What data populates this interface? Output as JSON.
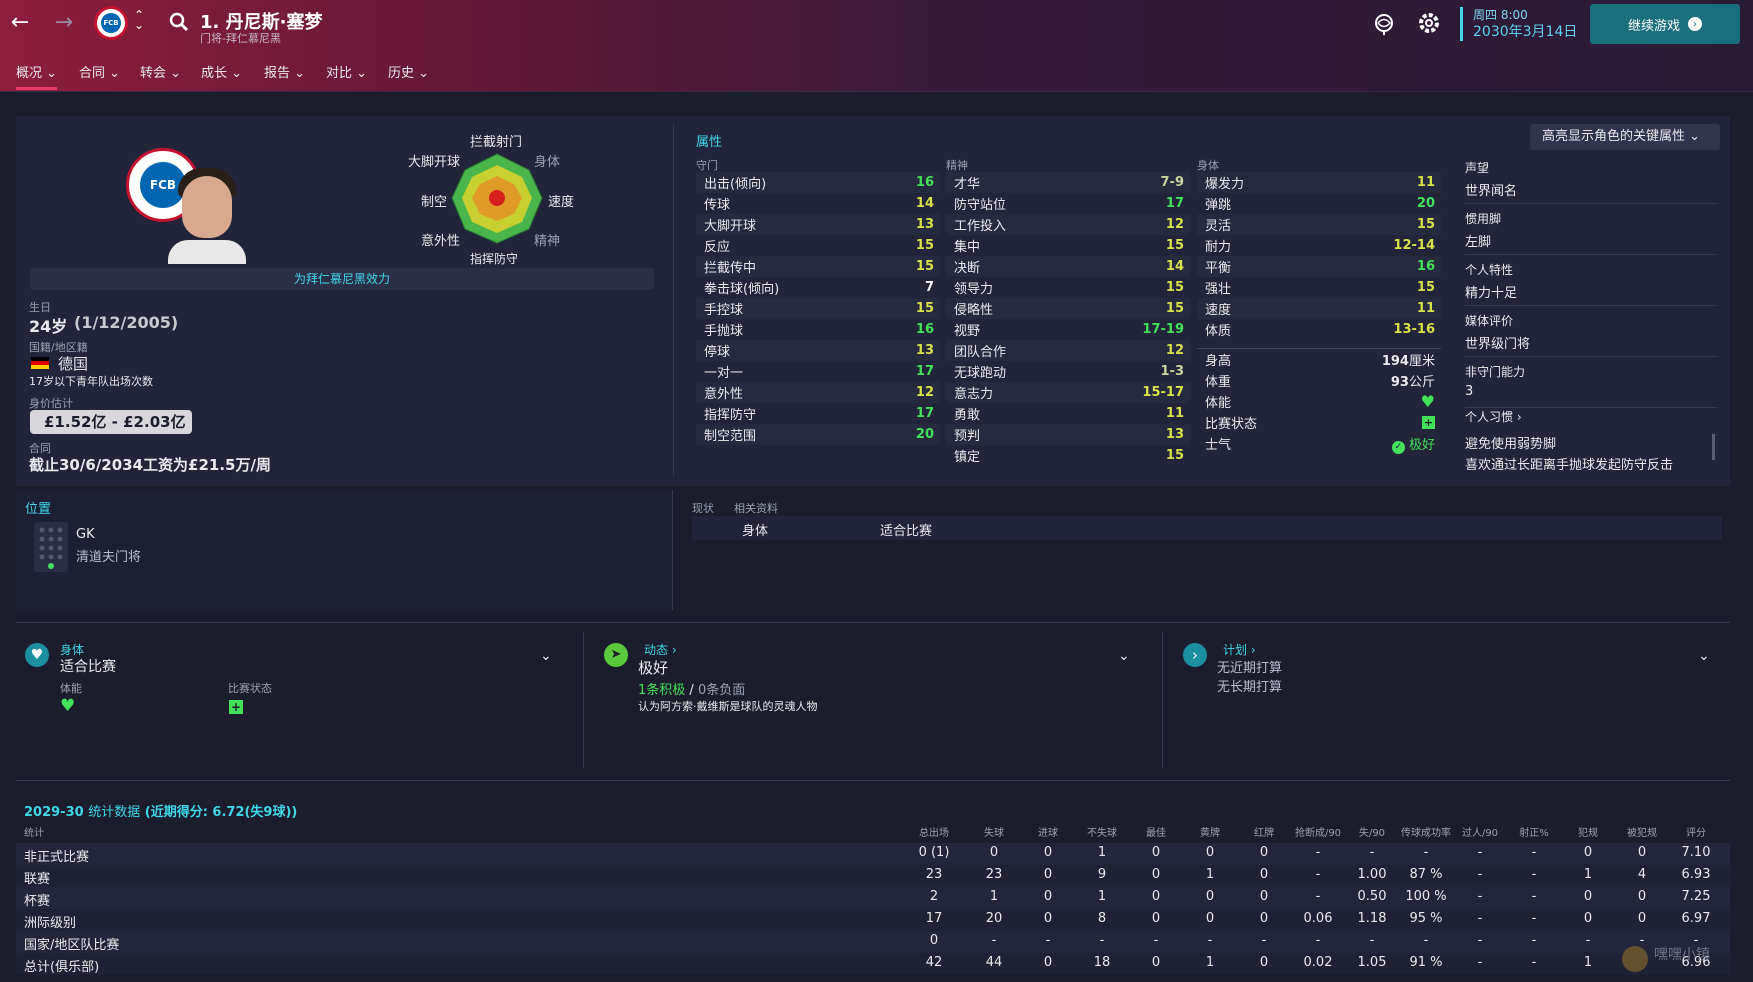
{
  "header": {
    "player_title": "1. 丹尼斯·塞梦",
    "player_subtitle": "门将-拜仁慕尼黑",
    "date_line1": "周四 8:00",
    "date_line2": "2030年3月14日",
    "continue": "继续游戏",
    "back_icon": "←",
    "forward_icon": "→",
    "search_icon": "⚲"
  },
  "menu": [
    "概况",
    "合同",
    "转会",
    "成长",
    "报告",
    "对比",
    "历史"
  ],
  "profile": {
    "plays_for": "为拜仁慕尼黑效力",
    "birth_label": "生日",
    "age": "24岁",
    "birth": "(1/12/2005)",
    "nation_label": "国籍/地区籍",
    "nation": "德国",
    "youth_caps": "17岁以下青年队出场次数",
    "value_label": "身价估计",
    "value": "£1.52亿 - £2.03亿",
    "contract_label": "合同",
    "contract": "截止30/6/2034工资为£21.5万/周"
  },
  "radar": {
    "top": "拦截射门",
    "tl": "大脚开球",
    "tr": "身体",
    "left": "制空",
    "right": "速度",
    "bl": "意外性",
    "br": "精神",
    "bottom": "指挥防守"
  },
  "attributes": {
    "title": "属性",
    "highlight": "高亮显示角色的关键属性",
    "gk_header": "守门",
    "mental_header": "精神",
    "physical_header": "身体",
    "gk": [
      [
        "出击(倾向)",
        "16",
        "g"
      ],
      [
        "传球",
        "14",
        "y"
      ],
      [
        "大脚开球",
        "13",
        "y"
      ],
      [
        "反应",
        "15",
        "y"
      ],
      [
        "拦截传中",
        "15",
        "y"
      ],
      [
        "拳击球(倾向)",
        "7",
        "w"
      ],
      [
        "手控球",
        "15",
        "y"
      ],
      [
        "手抛球",
        "16",
        "g"
      ],
      [
        "停球",
        "13",
        "y"
      ],
      [
        "一对一",
        "17",
        "g"
      ],
      [
        "意外性",
        "12",
        "y"
      ],
      [
        "指挥防守",
        "17",
        "g"
      ],
      [
        "制空范围",
        "20",
        "g"
      ]
    ],
    "mental": [
      [
        "才华",
        "7-9",
        "p"
      ],
      [
        "防守站位",
        "17",
        "g"
      ],
      [
        "工作投入",
        "12",
        "y"
      ],
      [
        "集中",
        "15",
        "y"
      ],
      [
        "决断",
        "14",
        "y"
      ],
      [
        "领导力",
        "15",
        "y"
      ],
      [
        "侵略性",
        "15",
        "y"
      ],
      [
        "视野",
        "17-19",
        "g"
      ],
      [
        "团队合作",
        "12",
        "y"
      ],
      [
        "无球跑动",
        "1-3",
        "p"
      ],
      [
        "意志力",
        "15-17",
        "y"
      ],
      [
        "勇敢",
        "11",
        "y"
      ],
      [
        "预判",
        "13",
        "y"
      ],
      [
        "镇定",
        "15",
        "y"
      ]
    ],
    "physical": [
      [
        "爆发力",
        "11",
        "y"
      ],
      [
        "弹跳",
        "20",
        "g"
      ],
      [
        "灵活",
        "15",
        "y"
      ],
      [
        "耐力",
        "12-14",
        "y"
      ],
      [
        "平衡",
        "16",
        "g"
      ],
      [
        "强壮",
        "15",
        "y"
      ],
      [
        "速度",
        "11",
        "y"
      ],
      [
        "体质",
        "13-16",
        "y"
      ]
    ],
    "height_label": "身高",
    "height": "194",
    "height_unit": "厘米",
    "weight_label": "体重",
    "weight": "93",
    "weight_unit": "公斤",
    "fitness_label": "体能",
    "condition_label": "比赛状态",
    "morale_label": "士气",
    "morale": "极好"
  },
  "info": [
    {
      "label": "声望",
      "value": "世界闻名"
    },
    {
      "label": "惯用脚",
      "value": "左脚"
    },
    {
      "label": "个人特性",
      "value": "精力十足"
    },
    {
      "label": "媒体评价",
      "value": "世界级门将"
    },
    {
      "label": "非守门能力",
      "value": "3"
    }
  ],
  "habits": {
    "label": "个人习惯",
    "items": [
      "避免使用弱势脚",
      "喜欢通过长距离手抛球发起防守反击"
    ]
  },
  "position": {
    "title": "位置",
    "code": "GK",
    "role": "清道夫门将"
  },
  "status": {
    "tab1": "现状",
    "tab2": "相关资料",
    "col1": "身体",
    "col2": "适合比赛"
  },
  "cards": {
    "c1": {
      "title": "身体",
      "value": "适合比赛",
      "l1": "体能",
      "l2": "比赛状态"
    },
    "c2": {
      "title": "动态",
      "value": "极好",
      "pos": "1条积极",
      "sep": "/",
      "neg": "0条负面",
      "note": "认为阿方索·戴维斯是球队的灵魂人物"
    },
    "c3": {
      "title": "计划",
      "l1": "无近期打算",
      "l2": "无长期打算"
    }
  },
  "stats": {
    "title_season": "2029-30",
    "title_rest": "统计数据",
    "title_rating": "(近期得分: 6.72(失9球))",
    "row_header": "统计",
    "cols": [
      "总出场",
      "失球",
      "进球",
      "不失球",
      "最佳",
      "黄牌",
      "红牌",
      "抢断成/90",
      "失/90",
      "传球成功率",
      "过人/90",
      "射正%",
      "犯规",
      "被犯规",
      "评分"
    ],
    "rows": [
      {
        "name": "非正式比赛",
        "v": [
          "0 (1)",
          "0",
          "0",
          "1",
          "0",
          "0",
          "0",
          "-",
          "-",
          "-",
          "-",
          "-",
          "0",
          "0",
          "7.10"
        ]
      },
      {
        "name": "联赛",
        "v": [
          "23",
          "23",
          "0",
          "9",
          "0",
          "1",
          "0",
          "-",
          "1.00",
          "87 %",
          "-",
          "-",
          "1",
          "4",
          "6.93"
        ]
      },
      {
        "name": "杯赛",
        "v": [
          "2",
          "1",
          "0",
          "1",
          "0",
          "0",
          "0",
          "-",
          "0.50",
          "100 %",
          "-",
          "-",
          "0",
          "0",
          "7.25"
        ]
      },
      {
        "name": "洲际级别",
        "v": [
          "17",
          "20",
          "0",
          "8",
          "0",
          "0",
          "0",
          "0.06",
          "1.18",
          "95 %",
          "-",
          "-",
          "0",
          "0",
          "6.97"
        ]
      },
      {
        "name": "国家/地区队比赛",
        "v": [
          "0",
          "-",
          "-",
          "-",
          "-",
          "-",
          "-",
          "-",
          "-",
          "-",
          "-",
          "-",
          "-",
          "-",
          "-"
        ]
      },
      {
        "name": "总计(俱乐部)",
        "v": [
          "42",
          "44",
          "0",
          "18",
          "0",
          "1",
          "0",
          "0.02",
          "1.05",
          "91 %",
          "-",
          "-",
          "1",
          "",
          "6.96"
        ]
      }
    ]
  },
  "colors": {
    "accent": "#3fd6e8",
    "green": "#43e05a",
    "yellow": "#d8e04a",
    "brand": "#c4122f"
  }
}
